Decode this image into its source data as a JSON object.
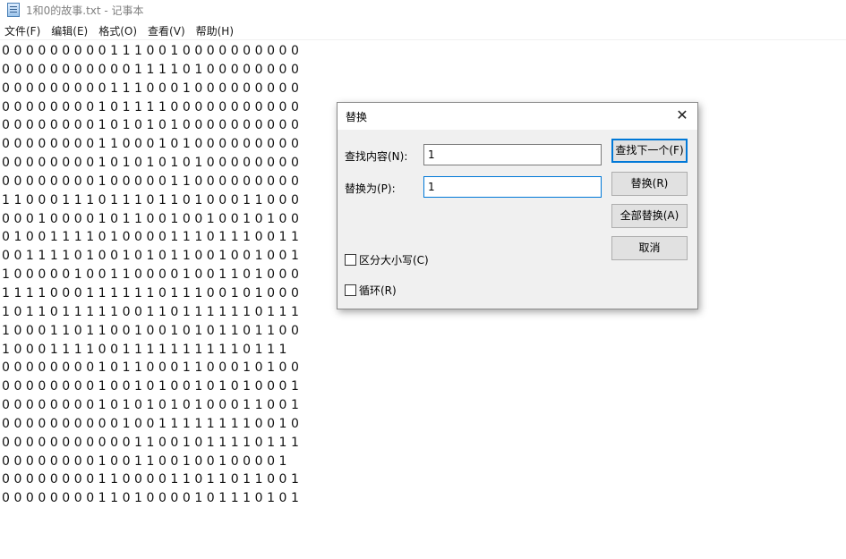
{
  "window": {
    "title": "1和0的故事.txt - 记事本",
    "app_icon": "notepad-icon"
  },
  "menu": [
    "文件(F)",
    "编辑(E)",
    "格式(O)",
    "查看(V)",
    "帮助(H)"
  ],
  "editor_lines": [
    "0 0 0 0 0 0 0 0 0 1 1 1 0 0 1 0 0 0 0 0 0 0 0 0 0",
    "0 0 0 0 0 0 0 0 0 0 0 1 1 1 1 0 1 0 0 0 0 0 0 0 0",
    "0 0 0 0 0 0 0 0 0 1 1 1 0 0 0 1 0 0 0 0 0 0 0 0 0",
    "0 0 0 0 0 0 0 0 1 0 1 1 1 1 0 0 0 0 0 0 0 0 0 0 0",
    "0 0 0 0 0 0 0 0 1 0 1 0 1 0 1 0 0 0 0 0 0 0 0 0 0",
    "0 0 0 0 0 0 0 0 1 1 0 0 0 1 0 1 0 0 0 0 0 0 0 0 0",
    "0 0 0 0 0 0 0 0 1 0 1 0 1 0 1 0 1 0 0 0 0 0 0 0 0",
    "0 0 0 0 0 0 0 0 1 0 0 0 0 0 1 1 0 0 0 0 0 0 0 0 0",
    "1 1 0 0 0 1 1 1 0 1 1 1 0 1 1 0 1 0 0 0 1 1 0 0 0",
    "0 0 0 1 0 0 0 0 1 0 1 1 0 0 1 0 0 1 0 0 1 0 1 0 0",
    "0 1 0 0 1 1 1 1 0 1 0 0 0 0 1 1 1 0 1 1 1 0 0 1 1",
    "0 0 1 1 1 1 0 1 0 0 1 0 1 0 1 1 0 0 1 0 0 1 0 0 1",
    "1 0 0 0 0 0 1 0 0 1 1 0 0 0 0 1 0 0 1 1 0 1 0 0 0",
    "1 1 1 1 0 0 0 1 1 1 1 1 1 0 1 1 1 0 0 1 0 1 0 0 0",
    "1 0 1 1 0 1 1 1 1 1 0 0 1 1 0 1 1 1 1 1 1 0 1 1 1",
    "1 0 0 0 1 1 0 1 1 0 0 1 0 0 1 0 1 0 1 1 0 1 1 0 0",
    "1 0 0 0 1 1 1 1 0 0 1 1 1 1 1 1 1 1 1 1 0 1 1 1",
    "0 0 0 0 0 0 0 0 1 0 1 1 0 0 0 1 1 0 0 0 1 0 1 0 0",
    "0 0 0 0 0 0 0 0 1 0 0 1 0 1 0 0 1 0 1 0 1 0 0 0 1",
    "0 0 0 0 0 0 0 0 1 0 1 0 1 0 1 0 1 0 0 0 1 1 0 0 1",
    "0 0 0 0 0 0 0 0 0 0 1 0 0 1 1 1 1 1 1 1 1 0 0 1 0",
    "0 0 0 0 0 0 0 0 0 0 0 1 1 0 0 1 0 1 1 1 1 0 1 1 1",
    "0 0 0 0 0 0 0 0 1 0 0 1 1 0 0 1 0 0 1 0 0 0 0 1",
    "0 0 0 0 0 0 0 0 1 1 0 0 0 0 1 1 0 1 1 0 1 1 0 0 1",
    "0 0 0 0 0 0 0 0 1 1 0 1 0 0 0 0 1 0 1 1 1 0 1 0 1"
  ],
  "dialog": {
    "title": "替换",
    "close_glyph": "✕",
    "find_label": "查找内容(N):",
    "find_value": "1",
    "replace_label": "替换为(P):",
    "replace_value": "1",
    "buttons": {
      "find_next": "查找下一个(F)",
      "replace": "替换(R)",
      "replace_all": "全部替换(A)",
      "cancel": "取消"
    },
    "match_case": {
      "label": "区分大小写(C)",
      "checked": false
    },
    "wrap": {
      "label": "循环(R)",
      "checked": false
    }
  },
  "colors": {
    "focus_border": "#0078d7",
    "dialog_bg": "#f0f0f0"
  }
}
